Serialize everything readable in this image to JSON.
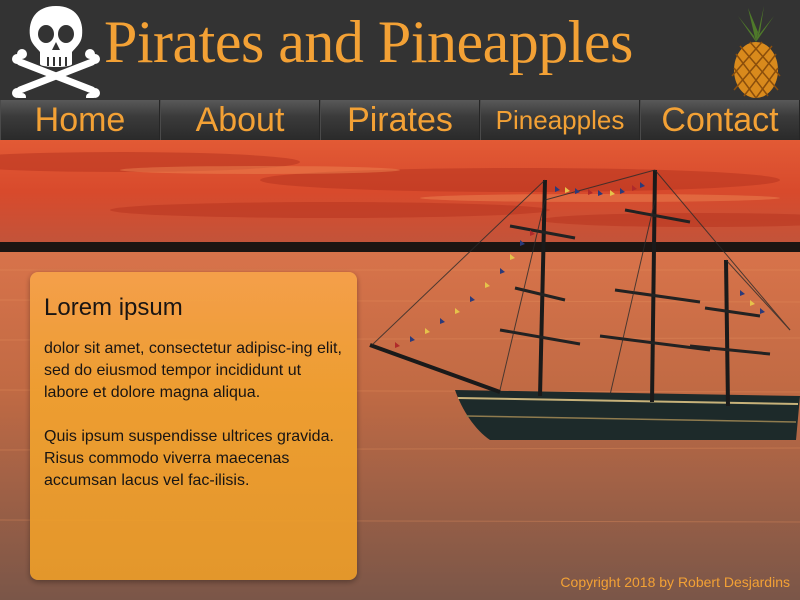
{
  "header": {
    "title": "Pirates and Pineapples",
    "skull_icon": "skull-and-crossbones-icon",
    "pineapple_icon": "pineapple-icon"
  },
  "nav": {
    "items": [
      {
        "label": "Home"
      },
      {
        "label": "About"
      },
      {
        "label": "Pirates"
      },
      {
        "label": "Pineapples"
      },
      {
        "label": "Contact"
      }
    ]
  },
  "content": {
    "heading": "Lorem ipsum",
    "paragraph1": "dolor sit amet, consectetur adipisc-ing elit, sed do eiusmod tempor incididunt ut labore et dolore magna aliqua.",
    "paragraph2": "Quis ipsum suspendisse ultrices gravida. Risus commodo viverra maecenas accumsan lacus vel fac-ilisis."
  },
  "footer": {
    "copyright": "Copyright 2018 by Robert Desjardins"
  },
  "colors": {
    "accent": "#f3a135",
    "header_bg": "#333333",
    "card_bg": "#f0a030"
  }
}
